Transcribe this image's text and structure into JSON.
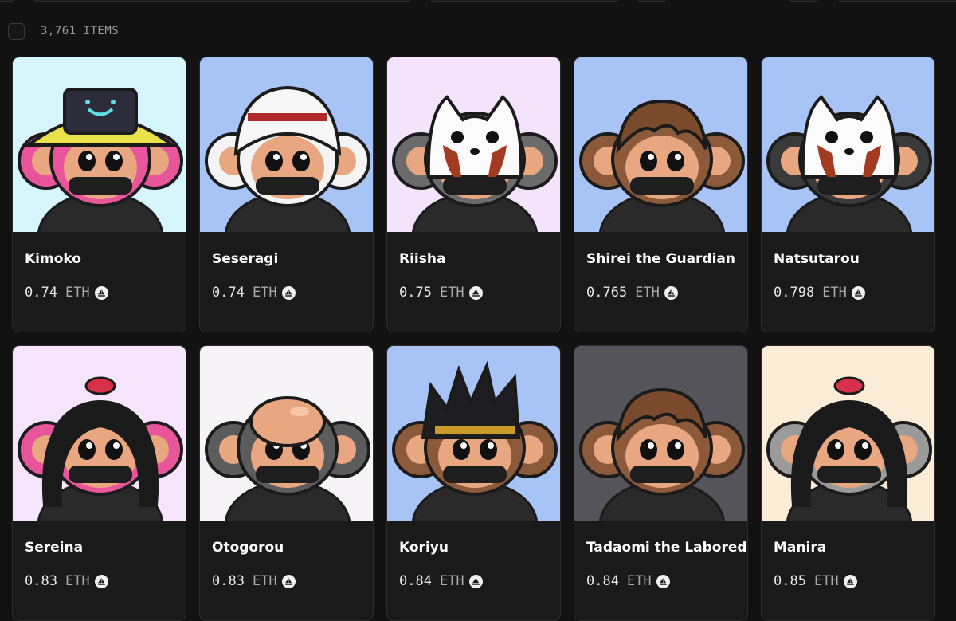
{
  "collection": {
    "items_count": "3,761 ITEMS"
  },
  "items": [
    {
      "name": "Kimoko",
      "price": "0.74",
      "currency": "ETH",
      "bg": "#d6f6fb",
      "fur": "#e9559a",
      "head": "yellow-hat"
    },
    {
      "name": "Seseragi",
      "price": "0.74",
      "currency": "ETH",
      "bg": "#a8c4f7",
      "fur": "#f4f4f4",
      "head": "white-hood"
    },
    {
      "name": "Riisha",
      "price": "0.75",
      "currency": "ETH",
      "bg": "#f3e4fb",
      "fur": "#6b6b6b",
      "head": "panda-mask"
    },
    {
      "name": "Shirei the Guardian",
      "price": "0.765",
      "currency": "ETH",
      "bg": "#a8c4f7",
      "fur": "#8a5a3b",
      "head": "brown-hair"
    },
    {
      "name": "Natsutarou",
      "price": "0.798",
      "currency": "ETH",
      "bg": "#a8c4f7",
      "fur": "#3a3a3a",
      "head": "panda-mask"
    },
    {
      "name": "Sereina",
      "price": "0.83",
      "currency": "ETH",
      "bg": "#f5e4fb",
      "fur": "#e9559a",
      "head": "black-hair"
    },
    {
      "name": "Otogorou",
      "price": "0.83",
      "currency": "ETH",
      "bg": "#f6f4f7",
      "fur": "#5c5c5c",
      "head": "bald"
    },
    {
      "name": "Koriyu",
      "price": "0.84",
      "currency": "ETH",
      "bg": "#a8c4f7",
      "fur": "#8a5a3b",
      "head": "spiky-hair"
    },
    {
      "name": "Tadaomi the Labored",
      "price": "0.84",
      "currency": "ETH",
      "bg": "#54545a",
      "fur": "#8a5a3b",
      "head": "brown-hair"
    },
    {
      "name": "Manira",
      "price": "0.85",
      "currency": "ETH",
      "bg": "#fbecd8",
      "fur": "#9a9a9a",
      "head": "black-hair"
    }
  ]
}
